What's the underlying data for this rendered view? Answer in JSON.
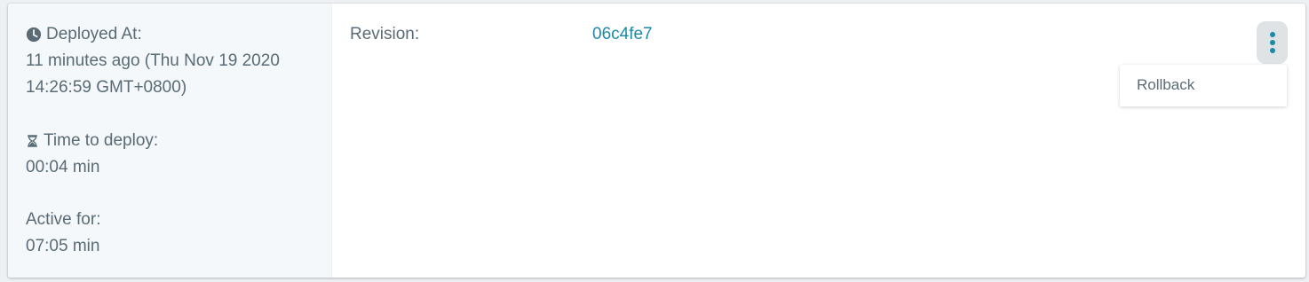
{
  "deployment": {
    "deployed_at_label": "Deployed At:",
    "deployed_at_relative": "11 minutes ago (Thu Nov 19 2020",
    "deployed_at_time": "14:26:59 GMT+0800)",
    "time_to_deploy_label": "Time to deploy:",
    "time_to_deploy_value": "00:04 min",
    "active_for_label": "Active for:",
    "active_for_value": "07:05 min"
  },
  "revision": {
    "label": "Revision:",
    "value": "06c4fe7"
  },
  "menu": {
    "items": [
      {
        "label": "Rollback"
      }
    ]
  },
  "icons": {
    "deployed_at": "clock-icon",
    "time_to_deploy": "hourglass-icon",
    "menu": "more-vertical-icon"
  },
  "colors": {
    "accent": "#1b8aa6",
    "text": "#5a6b75",
    "left_panel_bg": "#f4f8fb",
    "menu_button_bg": "#dfe3e6"
  }
}
